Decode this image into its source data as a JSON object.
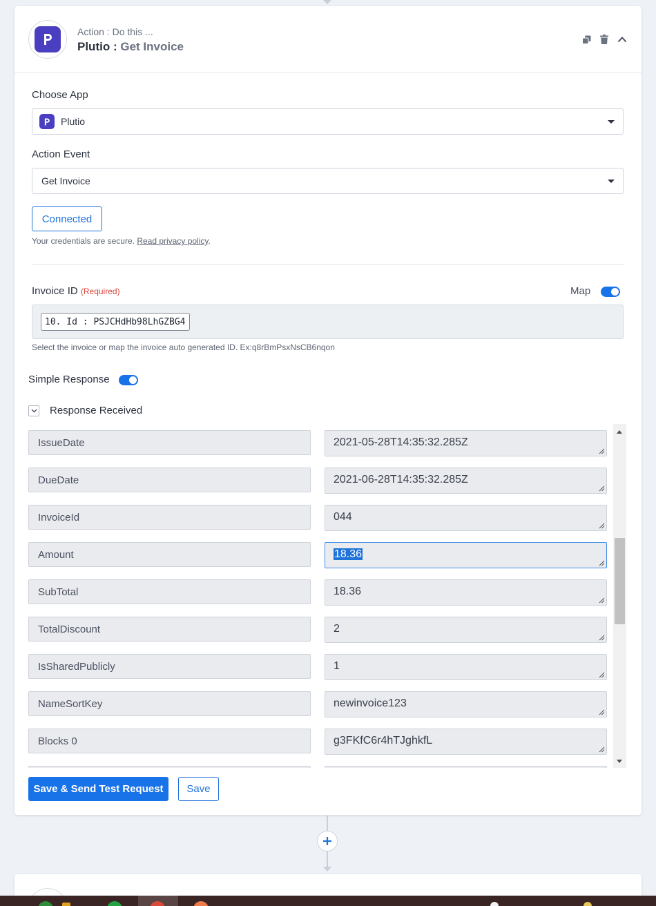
{
  "step": {
    "type_label": "Action : Do this ...",
    "app_name": "Plutio :",
    "event_name": "Get Invoice"
  },
  "choose_app": {
    "label": "Choose App",
    "value": "Plutio"
  },
  "action_event": {
    "label": "Action Event",
    "value": "Get Invoice"
  },
  "connection": {
    "button_label": "Connected",
    "secure_text": "Your credentials are secure.",
    "privacy_link": "Read privacy policy",
    "period": "."
  },
  "invoice_id": {
    "label": "Invoice ID",
    "required": "(Required)",
    "map_label": "Map",
    "map_enabled": true,
    "mapped_value": "10. Id : PSJCHdHb98LhGZBG4",
    "help_text": "Select the invoice or map the invoice auto generated ID. Ex:q8rBmPsxNsCB6nqon"
  },
  "simple_response": {
    "label": "Simple Response",
    "enabled": true
  },
  "response": {
    "label": "Response Received",
    "rows": [
      {
        "key": "IssueDate",
        "value": "2021-05-28T14:35:32.285Z"
      },
      {
        "key": "DueDate",
        "value": "2021-06-28T14:35:32.285Z"
      },
      {
        "key": "InvoiceId",
        "value": "044"
      },
      {
        "key": "Amount",
        "value": "18.36"
      },
      {
        "key": "SubTotal",
        "value": "18.36"
      },
      {
        "key": "TotalDiscount",
        "value": "2"
      },
      {
        "key": "IsSharedPublicly",
        "value": "1"
      },
      {
        "key": "NameSortKey",
        "value": "newinvoice123"
      },
      {
        "key": "Blocks 0",
        "value": "g3FKfC6r4hTJghkfL"
      }
    ]
  },
  "actions": {
    "save_test_label": "Save & Send Test Request",
    "save_label": "Save"
  },
  "colors": {
    "accent": "#1872e8",
    "brand": "#4a3fc1",
    "required": "#d9443a"
  }
}
